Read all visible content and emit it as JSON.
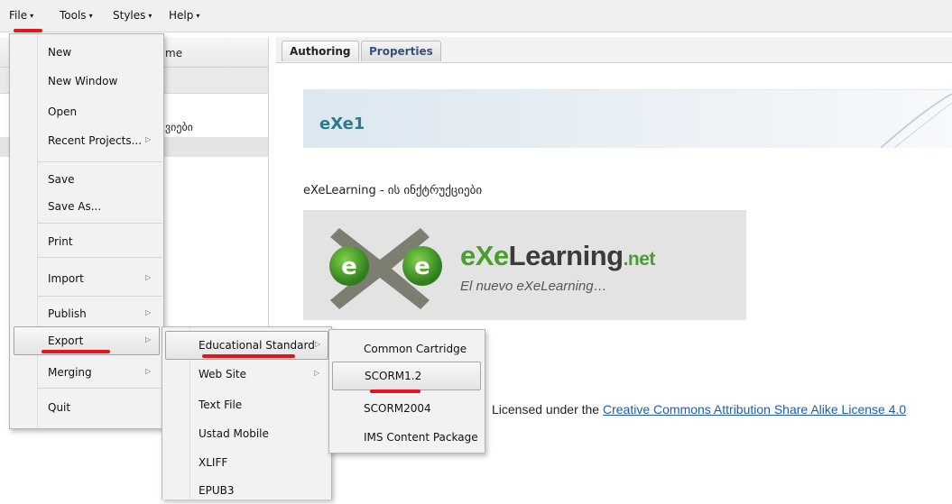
{
  "menubar": {
    "file": "File",
    "tools": "Tools",
    "styles": "Styles",
    "help": "Help",
    "dropdown_glyph": "▾"
  },
  "left_panel": {
    "header_text": "me",
    "node_text": "ვიები"
  },
  "tabs": {
    "authoring": "Authoring",
    "properties": "Properties"
  },
  "content": {
    "banner_title": "eXe1",
    "intro_text": "eXeLearning  - ის ინქტრუქციები",
    "logo": {
      "main_prefix": "eXe",
      "main_suffix": "Learning",
      "net": ".net",
      "tagline": "El nuevo eXeLearning…"
    },
    "license_prefix": "Licensed under the ",
    "license_link": "Creative Commons Attribution Share Alike License 4.0"
  },
  "file_menu": {
    "items": [
      {
        "label": "New"
      },
      {
        "label": "New Window"
      },
      {
        "label": "Open"
      },
      {
        "label": "Recent Projects...",
        "submenu": true
      },
      {
        "label": "Save"
      },
      {
        "label": "Save As..."
      },
      {
        "label": "Print"
      },
      {
        "label": "Import",
        "submenu": true
      },
      {
        "label": "Publish",
        "submenu": true
      },
      {
        "label": "Export",
        "submenu": true,
        "highlighted": true
      },
      {
        "label": "Merging",
        "submenu": true
      },
      {
        "label": "Quit"
      }
    ]
  },
  "export_menu": {
    "items": [
      {
        "label": "Educational Standard",
        "submenu": true,
        "highlighted": true
      },
      {
        "label": "Web Site",
        "submenu": true
      },
      {
        "label": "Text File"
      },
      {
        "label": "Ustad Mobile"
      },
      {
        "label": "XLIFF"
      },
      {
        "label": "EPUB3"
      }
    ]
  },
  "standard_menu": {
    "items": [
      {
        "label": "Common Cartridge"
      },
      {
        "label": "SCORM1.2",
        "highlighted": true
      },
      {
        "label": "SCORM2004"
      },
      {
        "label": "IMS Content Package"
      }
    ]
  },
  "submenu_arrow": "▷",
  "colors": {
    "annotation_red": "#e5161b",
    "banner_title": "#2d7a8c",
    "logo_green": "#4a9d2e",
    "link_blue": "#1a5bb5"
  }
}
